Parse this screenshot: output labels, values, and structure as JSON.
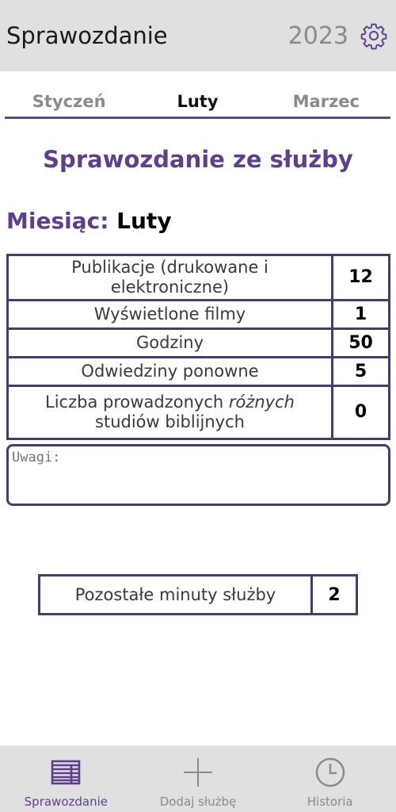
{
  "header": {
    "title": "Sprawozdanie",
    "year": "2023",
    "settings_icon": "gear-icon"
  },
  "tabs": [
    {
      "label": "Styczeń",
      "active": false
    },
    {
      "label": "Luty",
      "active": true
    },
    {
      "label": "Marzec",
      "active": false
    }
  ],
  "report": {
    "title": "Sprawozdanie ze służby",
    "month_label": "Miesiąc:",
    "month_value": "Luty"
  },
  "stats": [
    {
      "label": "Publikacje (drukowane i elektroniczne)",
      "value": "12"
    },
    {
      "label": "Wyświetlone filmy",
      "value": "1"
    },
    {
      "label": "Godziny",
      "value": "50"
    },
    {
      "label": "Odwiedziny ponowne",
      "value": "5"
    },
    {
      "label_pre": "Liczba prowadzonych ",
      "label_em": "różnych",
      "label_post": " studiów biblijnych",
      "value": "0"
    }
  ],
  "notes": {
    "placeholder": "Uwagi:",
    "value": ""
  },
  "remaining": {
    "label": "Pozostałe minuty służby",
    "value": "2"
  },
  "bottom_nav": [
    {
      "label": "Sprawozdanie",
      "icon": "report-table-icon",
      "active": true
    },
    {
      "label": "Dodaj służbę",
      "icon": "plus-icon",
      "active": false
    },
    {
      "label": "Historia",
      "icon": "clock-icon",
      "active": false
    }
  ],
  "colors": {
    "accent": "#5e3f8c",
    "border": "#4a3a6e",
    "header_bg": "#e0e0e0",
    "inactive_text": "#8a8a8a"
  }
}
